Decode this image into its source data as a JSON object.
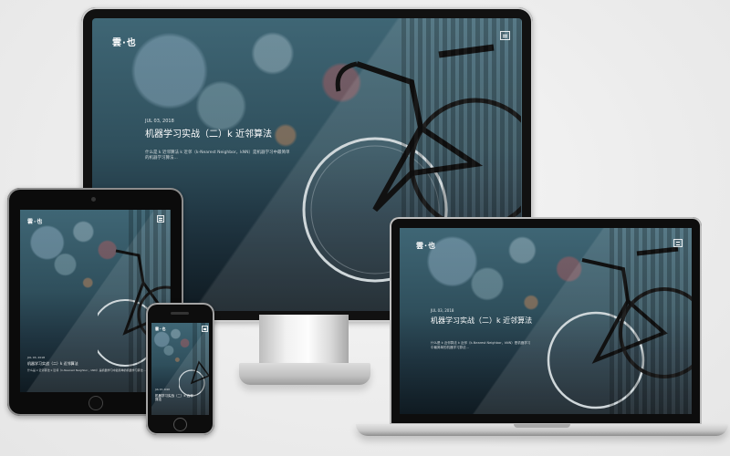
{
  "site": {
    "logo": "雲·也",
    "date": "JUL 03, 2018",
    "title": "机器学习实战（二）k 近邻算法",
    "description": "什么是 k 近邻算法 k 近邻（k-Nearest Neighbor，kNN）是机器学习中最简单的机器学习算法..."
  },
  "phone": {
    "date": "JUL 03, 2018",
    "title": "机器学习实战（二）k 近邻算法"
  },
  "devices": [
    "iMac",
    "iPad",
    "iPhone",
    "MacBook"
  ]
}
